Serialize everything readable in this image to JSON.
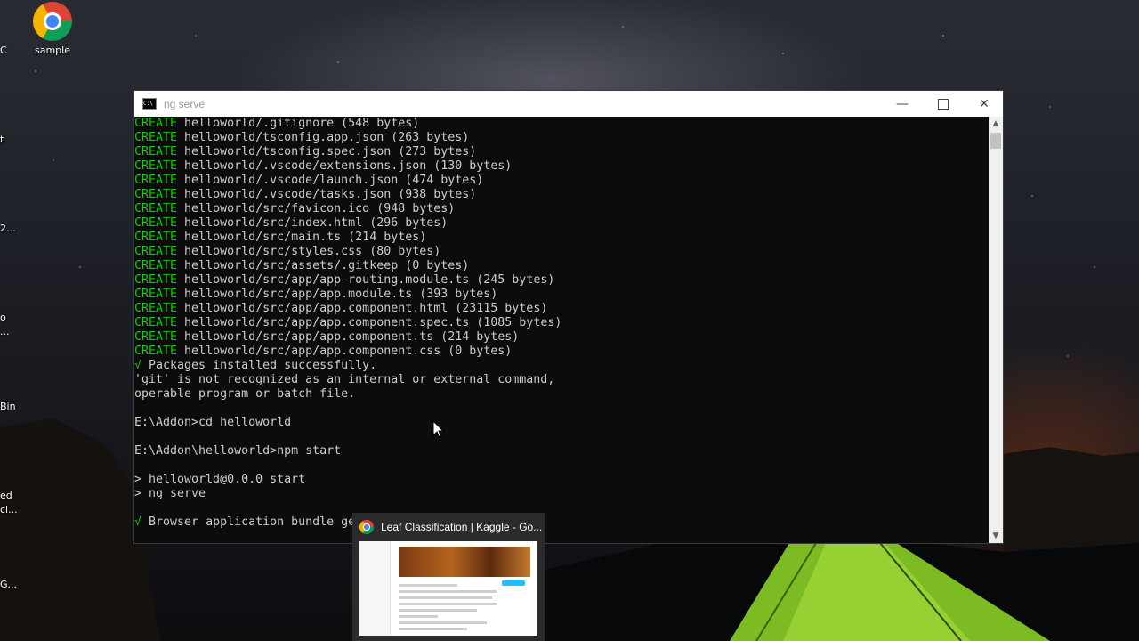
{
  "desktop": {
    "icon_label": "sample",
    "edge_fragments": [
      "C",
      "t",
      "2...",
      "o",
      "...",
      "Bin",
      "ed",
      "cl...",
      "G..."
    ]
  },
  "window": {
    "title": "ng serve",
    "cmd_icon_text": "C:\\",
    "lines": [
      {
        "prefix": "CREATE",
        "text": " helloworld/.gitignore (548 bytes)"
      },
      {
        "prefix": "CREATE",
        "text": " helloworld/tsconfig.app.json (263 bytes)"
      },
      {
        "prefix": "CREATE",
        "text": " helloworld/tsconfig.spec.json (273 bytes)"
      },
      {
        "prefix": "CREATE",
        "text": " helloworld/.vscode/extensions.json (130 bytes)"
      },
      {
        "prefix": "CREATE",
        "text": " helloworld/.vscode/launch.json (474 bytes)"
      },
      {
        "prefix": "CREATE",
        "text": " helloworld/.vscode/tasks.json (938 bytes)"
      },
      {
        "prefix": "CREATE",
        "text": " helloworld/src/favicon.ico (948 bytes)"
      },
      {
        "prefix": "CREATE",
        "text": " helloworld/src/index.html (296 bytes)"
      },
      {
        "prefix": "CREATE",
        "text": " helloworld/src/main.ts (214 bytes)"
      },
      {
        "prefix": "CREATE",
        "text": " helloworld/src/styles.css (80 bytes)"
      },
      {
        "prefix": "CREATE",
        "text": " helloworld/src/assets/.gitkeep (0 bytes)"
      },
      {
        "prefix": "CREATE",
        "text": " helloworld/src/app/app-routing.module.ts (245 bytes)"
      },
      {
        "prefix": "CREATE",
        "text": " helloworld/src/app/app.module.ts (393 bytes)"
      },
      {
        "prefix": "CREATE",
        "text": " helloworld/src/app/app.component.html (23115 bytes)"
      },
      {
        "prefix": "CREATE",
        "text": " helloworld/src/app/app.component.spec.ts (1085 bytes)"
      },
      {
        "prefix": "CREATE",
        "text": " helloworld/src/app/app.component.ts (214 bytes)"
      },
      {
        "prefix": "CREATE",
        "text": " helloworld/src/app/app.component.css (0 bytes)"
      },
      {
        "prefix": "√",
        "text": " Packages installed successfully."
      },
      {
        "prefix": "",
        "text": "'git' is not recognized as an internal or external command,"
      },
      {
        "prefix": "",
        "text": "operable program or batch file."
      },
      {
        "prefix": "",
        "text": ""
      },
      {
        "prefix": "",
        "text": "E:\\Addon>cd helloworld"
      },
      {
        "prefix": "",
        "text": ""
      },
      {
        "prefix": "",
        "text": "E:\\Addon\\helloworld>npm start"
      },
      {
        "prefix": "",
        "text": ""
      },
      {
        "prefix": "",
        "text": "> helloworld@0.0.0 start"
      },
      {
        "prefix": "",
        "text": "> ng serve"
      },
      {
        "prefix": "",
        "text": ""
      },
      {
        "prefix": "√",
        "text": " Browser application bundle ge"
      }
    ]
  },
  "taskbar_preview": {
    "title": "Leaf Classification | Kaggle - Go..."
  },
  "colors": {
    "console_bg": "#0c0c0c",
    "console_text": "#cccccc",
    "create_green": "#16c60c"
  }
}
